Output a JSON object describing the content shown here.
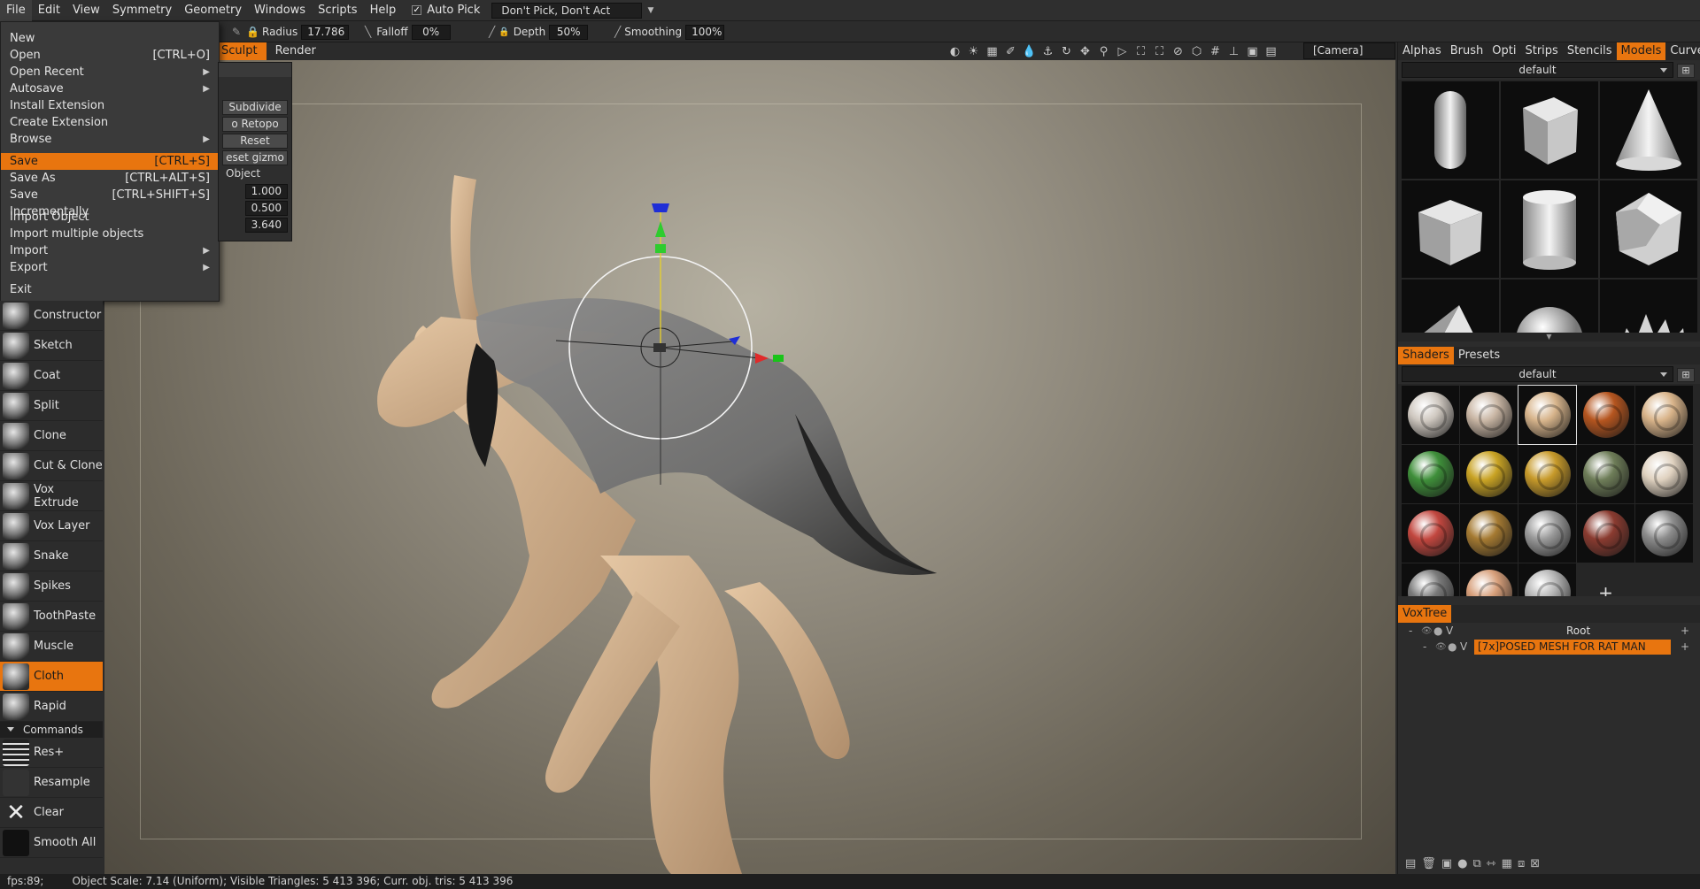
{
  "menubar": {
    "items": [
      "File",
      "Edit",
      "View",
      "Symmetry",
      "Geometry",
      "Windows",
      "Scripts",
      "Help"
    ],
    "auto_pick": "Auto Pick",
    "dont_pick": "Don't Pick, Don't Act"
  },
  "toolbar": {
    "radius_label": "Radius",
    "radius_value": "17.786",
    "falloff_label": "Falloff",
    "falloff_value": "0%",
    "depth_label": "Depth",
    "depth_value": "50%",
    "smoothing_label": "Smoothing",
    "smoothing_value": "100%"
  },
  "room_tabs": [
    "Sculpt",
    "Render"
  ],
  "camera": "[Camera]",
  "file_menu": {
    "items": [
      {
        "label": "New",
        "shortcut": ""
      },
      {
        "label": "Open",
        "shortcut": "[CTRL+O]"
      },
      {
        "label": "Open Recent",
        "shortcut": "",
        "submenu": true
      },
      {
        "label": "Autosave",
        "shortcut": "",
        "submenu": true
      },
      {
        "label": "Install Extension",
        "shortcut": ""
      },
      {
        "label": "Create Extension",
        "shortcut": ""
      },
      {
        "label": "Browse",
        "shortcut": "",
        "submenu": true
      },
      {
        "sep": true
      },
      {
        "label": "Save",
        "shortcut": "[CTRL+S]",
        "active": true
      },
      {
        "label": "Save As",
        "shortcut": "[CTRL+ALT+S]"
      },
      {
        "label": "Save Incrementally",
        "shortcut": "[CTRL+SHIFT+S]"
      },
      {
        "sep": true
      },
      {
        "label": "Import Object",
        "shortcut": ""
      },
      {
        "label": "Import multiple objects",
        "shortcut": ""
      },
      {
        "label": "Import",
        "shortcut": "",
        "submenu": true
      },
      {
        "label": "Export",
        "shortcut": "",
        "submenu": true
      },
      {
        "sep": true
      },
      {
        "label": "Exit",
        "shortcut": ""
      }
    ]
  },
  "sub_panel": {
    "buttons": [
      "Subdivide",
      "o Retopo",
      "Reset",
      "eset gizmo"
    ],
    "label": "Object",
    "values": [
      "1.000",
      "0.500",
      "3.640"
    ]
  },
  "tools": [
    {
      "label": "Constructor"
    },
    {
      "label": "Sketch"
    },
    {
      "label": "Coat"
    },
    {
      "label": "Split"
    },
    {
      "label": "Clone"
    },
    {
      "label": "Cut & Clone"
    },
    {
      "label": "Vox Extrude"
    },
    {
      "label": "Vox Layer"
    },
    {
      "label": "Snake"
    },
    {
      "label": "Spikes"
    },
    {
      "label": "ToothPaste"
    },
    {
      "label": "Muscle"
    },
    {
      "label": "Cloth",
      "active": true
    },
    {
      "label": "Rapid"
    }
  ],
  "commands_header": "Commands",
  "commands": [
    {
      "label": "Res+"
    },
    {
      "label": "Resample"
    },
    {
      "label": "Clear"
    },
    {
      "label": "Smooth All"
    }
  ],
  "right": {
    "tabs": [
      "Alphas",
      "Brush",
      "Opti",
      "Strips",
      "Stencils",
      "Models",
      "Curves"
    ],
    "active_tab": "Models",
    "models_preset": "default",
    "shader_tabs": [
      "Shaders",
      "Presets"
    ],
    "shaders_preset": "default",
    "shader_colors": [
      "#cfc8c0",
      "#c9b6a4",
      "#d7b48b",
      "#b5551f",
      "#d9b48a",
      "#3f8f3a",
      "#c9a324",
      "#c79a2a",
      "#6e7d58",
      "#e0d2c0",
      "#c2473f",
      "#a57a32",
      "#9a9a9a",
      "#8a3b30",
      "#8c8c8c",
      "#7a7a7a",
      "#d79f7a",
      "#b5b5b5"
    ],
    "voxtree_tab": "VoxTree",
    "voxtree": [
      {
        "label": "Root",
        "active": false
      },
      {
        "label": "[7x]POSED MESH FOR RAT MAN",
        "active": true
      }
    ]
  },
  "status": {
    "fps": "fps:89;",
    "info": "Object Scale: 7.14 (Uniform); Visible Triangles: 5 413 396; Curr. obj. tris: 5 413 396"
  }
}
